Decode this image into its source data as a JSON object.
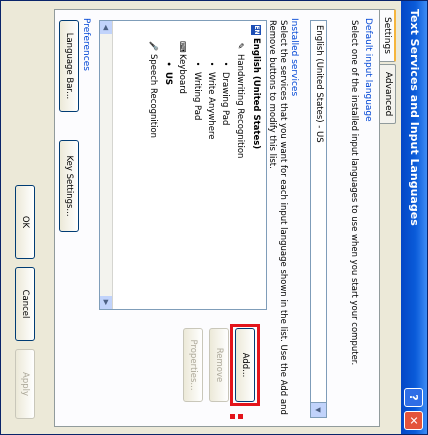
{
  "window": {
    "title": "Text Services and Input Languages",
    "help_glyph": "?",
    "close_glyph": "✕"
  },
  "tabs": [
    {
      "label": "Settings",
      "active": true
    },
    {
      "label": "Advanced",
      "active": false
    }
  ],
  "default_input_language": {
    "group_title": "Default input language",
    "description": "Select one of the installed input languages to use when you start your computer.",
    "selected_value": "English (United States) - US"
  },
  "installed_services": {
    "group_title": "Installed services",
    "description": "Select the services that you want for each input language shown in the list. Use the Add and Remove buttons to modify this list.",
    "tree": {
      "language": "English (United States)",
      "language_badge": "EN",
      "items": [
        {
          "label": "Handwriting Recognition",
          "level": 1
        },
        {
          "label": "Drawing Pad",
          "level": 2
        },
        {
          "label": "Write Anywhere",
          "level": 2
        },
        {
          "label": "Writing Pad",
          "level": 2
        },
        {
          "label": "Keyboard",
          "level": 1
        },
        {
          "label": "US",
          "level": 2
        },
        {
          "label": "Speech Recognition",
          "level": 1
        }
      ]
    },
    "buttons": {
      "add": "Add...",
      "remove": "Remove",
      "properties": "Properties..."
    }
  },
  "preferences": {
    "group_title": "Preferences",
    "language_bar_button": "Language Bar...",
    "key_settings_button": "Key Settings..."
  },
  "footer": {
    "ok": "OK",
    "cancel": "Cancel",
    "apply": "Apply"
  },
  "colors": {
    "title_bar": "#0a5bd9",
    "group_title": "#0046d5",
    "highlight": "#e3141b"
  }
}
